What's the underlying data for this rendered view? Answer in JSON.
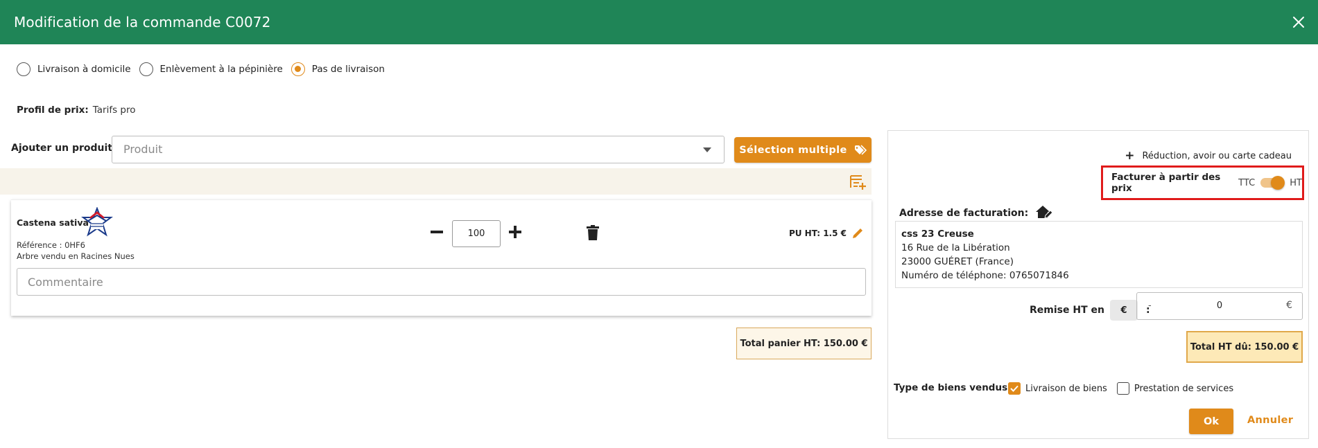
{
  "header": {
    "title": "Modification de la commande C0072",
    "close_icon": "close-icon"
  },
  "delivery": {
    "options": [
      {
        "label": "Livraison à domicile",
        "checked": false
      },
      {
        "label": "Enlèvement à la pépinière",
        "checked": false
      },
      {
        "label": "Pas de livraison",
        "checked": true
      }
    ]
  },
  "profil": {
    "label": "Profil de prix:",
    "value": "Tarifs pro"
  },
  "add_product": {
    "label": "Ajouter un produit :",
    "placeholder": "Produit",
    "multi_button": "Sélection multiple"
  },
  "product": {
    "name": "Castena sativa",
    "reference": "Référence : 0HF6",
    "type": "Arbre vendu en Racines Nues",
    "quantity": "100",
    "unit_price": "PU HT: 1.5 €",
    "comment_placeholder": "Commentaire"
  },
  "cart": {
    "total": "Total panier HT: 150.00 €"
  },
  "right": {
    "reduction": "Réduction, avoir ou carte cadeau",
    "facturer_label": "Facturer à partir des prix",
    "ttc": "TTC",
    "ht": "HT",
    "toggle_on": true,
    "address_label": "Adresse de facturation:",
    "address": {
      "name": "css 23 Creuse",
      "street": "16 Rue de la Libération",
      "city": "23000 GUÉRET (France)",
      "phone": "Numéro de téléphone: 0765071846"
    },
    "remise_label": "Remise HT en",
    "remise_unit": "€",
    "remise_colon": ":",
    "remise_sign": "-",
    "remise_value": "0",
    "remise_currency": "€",
    "total_due": "Total HT dû: 150.00 €",
    "biens_label": "Type de biens vendus :",
    "biens": [
      {
        "label": "Livraison de biens",
        "checked": true
      },
      {
        "label": "Prestation de services",
        "checked": false
      }
    ],
    "ok": "Ok",
    "annuler": "Annuler"
  },
  "colors": {
    "header": "#1f8557",
    "accent": "#e08a1a",
    "highlight": "#e01b1b"
  }
}
